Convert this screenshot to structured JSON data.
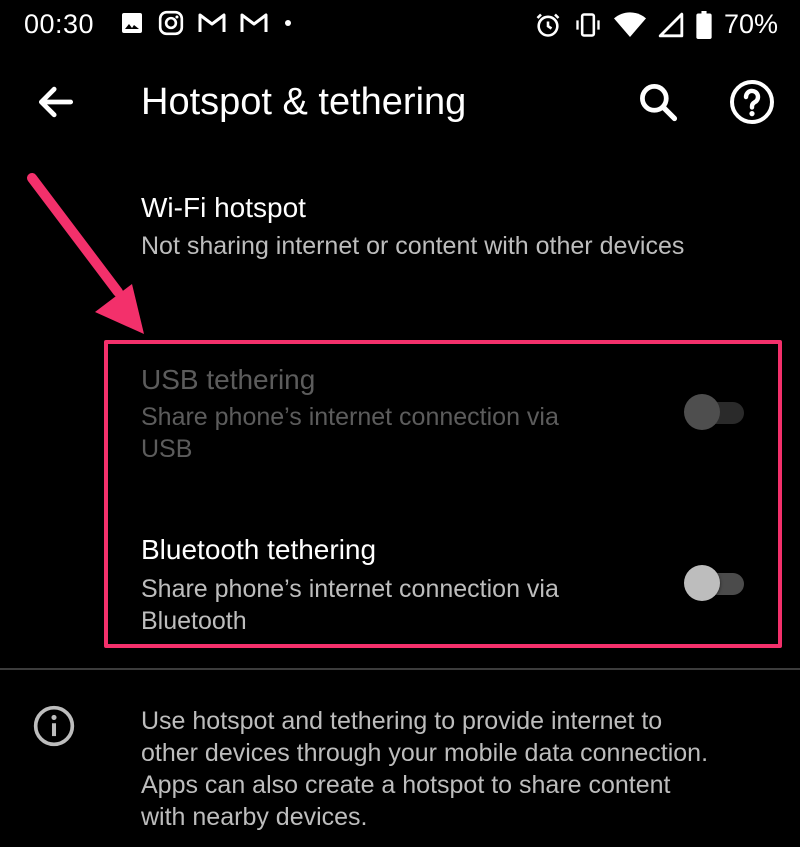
{
  "status_bar": {
    "time": "00:30",
    "left_icons": [
      "image-icon",
      "instagram-icon",
      "gmail-icon",
      "gmail-icon",
      "dot-icon"
    ],
    "right_icons": [
      "alarm-icon",
      "vibrate-icon",
      "wifi-icon",
      "signal-icon",
      "battery-icon"
    ],
    "battery": "70%"
  },
  "app_bar": {
    "title": "Hotspot & tethering",
    "back_icon": "arrow-back-icon",
    "search_icon": "search-icon",
    "help_icon": "help-icon"
  },
  "items": [
    {
      "title": "Wi-Fi hotspot",
      "subtitle": "Not sharing internet or content with other devices",
      "enabled": true
    },
    {
      "title": "USB tethering",
      "subtitle_line1": "Share phone’s internet connection via",
      "subtitle_line2": "USB",
      "enabled": false,
      "toggle_on": false
    },
    {
      "title": "Bluetooth tethering",
      "subtitle_line1": "Share phone’s internet connection via",
      "subtitle_line2": "Bluetooth",
      "enabled": true,
      "toggle_on": false
    }
  ],
  "info": {
    "icon": "info-icon",
    "line1": "Use hotspot and tethering to provide internet to",
    "line2": "other devices through your mobile data connection.",
    "line3": "Apps can also create a hotspot to share content",
    "line4": "with nearby devices."
  },
  "annotation": {
    "highlight_color": "#f3306b",
    "arrow_color": "#f3306b"
  }
}
